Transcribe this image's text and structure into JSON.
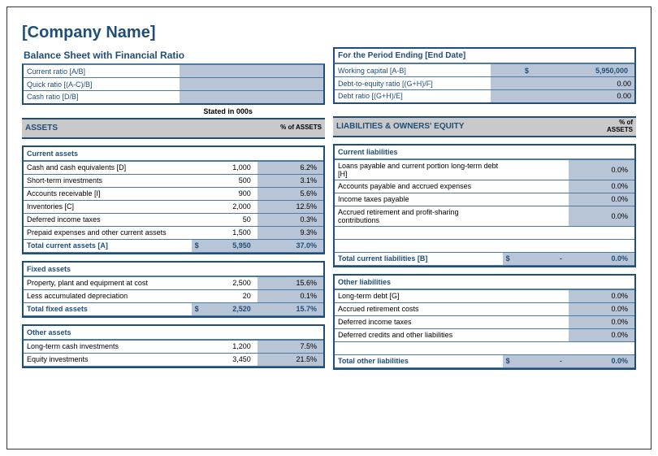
{
  "company_name": "[Company Name]",
  "left": {
    "title": "Balance Sheet with Financial Ratio",
    "ratios": [
      {
        "label": "Current ratio [A/B]",
        "value": ""
      },
      {
        "label": "Quick ratio [(A-C)/B]",
        "value": ""
      },
      {
        "label": "Cash ratio [D/B]",
        "value": ""
      }
    ],
    "stated": "Stated in 000s",
    "section_title": "ASSETS",
    "pct_label": "% of ASSETS",
    "current_assets": {
      "title": "Current assets",
      "rows": [
        {
          "label": "Cash and cash equivalents [D]",
          "amt": "1,000",
          "pct": "6.2%"
        },
        {
          "label": "Short-term investments",
          "amt": "500",
          "pct": "3.1%"
        },
        {
          "label": "Accounts receivable [I]",
          "amt": "900",
          "pct": "5.6%"
        },
        {
          "label": "Inventories [C]",
          "amt": "2,000",
          "pct": "12.5%"
        },
        {
          "label": "Deferred income taxes",
          "amt": "50",
          "pct": "0.3%"
        },
        {
          "label": "Prepaid expenses and other current assets",
          "amt": "1,500",
          "pct": "9.3%"
        }
      ],
      "total_label": "Total current assets [A]",
      "total_sym": "$",
      "total_amt": "5,950",
      "total_pct": "37.0%"
    },
    "fixed_assets": {
      "title": "Fixed assets",
      "rows": [
        {
          "label": "Property, plant and equipment at cost",
          "amt": "2,500",
          "pct": "15.6%"
        },
        {
          "label": "Less accumulated depreciation",
          "amt": "20",
          "pct": "0.1%"
        }
      ],
      "total_label": "Total fixed assets",
      "total_sym": "$",
      "total_amt": "2,520",
      "total_pct": "15.7%"
    },
    "other_assets": {
      "title": "Other assets",
      "rows": [
        {
          "label": "Long-term cash investments",
          "amt": "1,200",
          "pct": "7.5%"
        },
        {
          "label": "Equity investments",
          "amt": "3,450",
          "pct": "21.5%"
        }
      ]
    }
  },
  "right": {
    "period_title": "For the Period Ending [End Date]",
    "ratios": [
      {
        "label": "Working capital [A-B]",
        "sym": "$",
        "value": "5,950,000"
      },
      {
        "label": "Debt-to-equity ratio [(G+H)/F]",
        "value": "0.00"
      },
      {
        "label": "Debt ratio [(G+H)/E]",
        "value": "0.00"
      }
    ],
    "section_title": "LIABILITIES & OWNERS' EQUITY",
    "pct_label_line1": "% of",
    "pct_label_line2": "ASSETS",
    "current_liabilities": {
      "title": "Current liabilities",
      "rows": [
        {
          "label": "Loans payable and current portion long-term debt [H]",
          "pct": "0.0%"
        },
        {
          "label": "Accounts payable and accrued expenses",
          "pct": "0.0%"
        },
        {
          "label": "Income taxes payable",
          "pct": "0.0%"
        },
        {
          "label": "Accrued retirement and profit-sharing contributions",
          "pct": "0.0%"
        }
      ],
      "blank_rows": 2,
      "total_label": "Total current liabilities [B]",
      "total_sym": "$",
      "total_amt": "-",
      "total_pct": "0.0%"
    },
    "other_liabilities": {
      "title": "Other liabilities",
      "rows": [
        {
          "label": "Long-term debt [G]",
          "pct": "0.0%"
        },
        {
          "label": "Accrued retirement costs",
          "pct": "0.0%"
        },
        {
          "label": "Deferred income taxes",
          "pct": "0.0%"
        },
        {
          "label": "Deferred credits and other liabilities",
          "pct": "0.0%"
        }
      ],
      "blank_rows": 1,
      "total_label": "Total other liabilities",
      "total_sym": "$",
      "total_amt": "-",
      "total_pct": "0.0%"
    }
  }
}
